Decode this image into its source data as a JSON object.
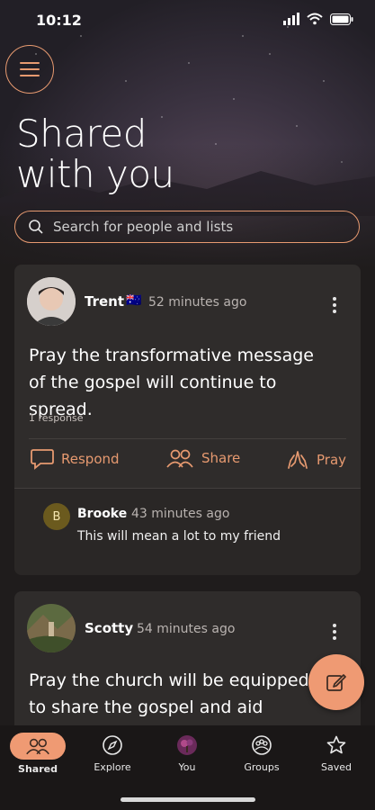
{
  "status": {
    "time": "10:12"
  },
  "header": {
    "title_line1": "Shared",
    "title_line2": "with you"
  },
  "search": {
    "placeholder": "Search for people and lists"
  },
  "posts": [
    {
      "author": "Trent",
      "flag": "🇦🇺",
      "time_ago": "52 minutes ago",
      "text": "Pray the transformative message of the gospel will continue to spread.",
      "response_count": "1 response",
      "actions": {
        "respond": "Respond",
        "share": "Share",
        "pray": "Pray"
      },
      "reply": {
        "initial": "B",
        "author": "Brooke",
        "time_ago": "43 minutes ago",
        "text": "This will mean a lot to my friend"
      }
    },
    {
      "author": "Scotty",
      "time_ago": "54 minutes ago",
      "text": "Pray the church will be equipped to share the gospel and aid those in"
    }
  ],
  "tabs": [
    {
      "label": "Shared",
      "icon": "people-icon"
    },
    {
      "label": "Explore",
      "icon": "compass-icon"
    },
    {
      "label": "You",
      "icon": "avatar-icon"
    },
    {
      "label": "Groups",
      "icon": "groups-icon"
    },
    {
      "label": "Saved",
      "icon": "star-icon"
    }
  ],
  "colors": {
    "accent": "#ef9a73",
    "card": "#2f2c2b",
    "background": "#1f1c1c"
  }
}
